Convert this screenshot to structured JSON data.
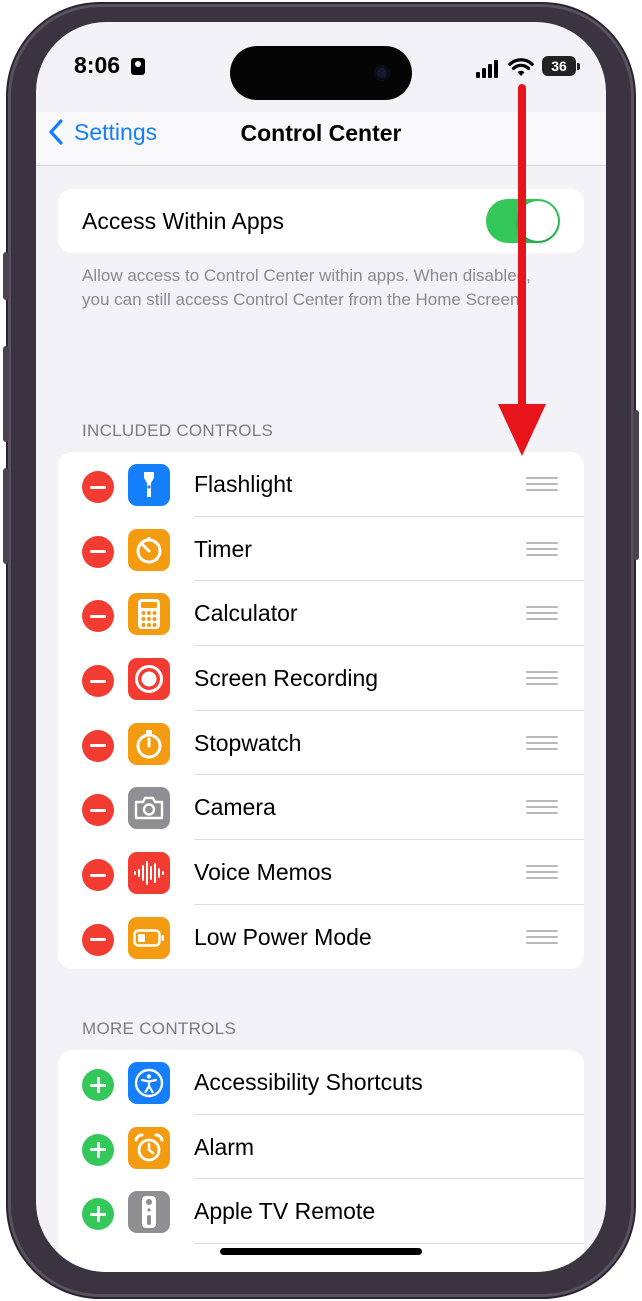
{
  "status": {
    "time": "8:06",
    "battery": "36"
  },
  "nav": {
    "back_label": "Settings",
    "title": "Control Center"
  },
  "access": {
    "label": "Access Within Apps",
    "enabled": true,
    "footnote": "Allow access to Control Center within apps. When disabled, you can still access Control Center from the Home Screen."
  },
  "included": {
    "header": "INCLUDED CONTROLS",
    "items": [
      {
        "label": "Flashlight",
        "icon": "flashlight-icon",
        "color": "#157efb"
      },
      {
        "label": "Timer",
        "icon": "timer-icon",
        "color": "#f39c12"
      },
      {
        "label": "Calculator",
        "icon": "calculator-icon",
        "color": "#f39c12"
      },
      {
        "label": "Screen Recording",
        "icon": "screen-recording-icon",
        "color": "#f23b31"
      },
      {
        "label": "Stopwatch",
        "icon": "stopwatch-icon",
        "color": "#f39c12"
      },
      {
        "label": "Camera",
        "icon": "camera-icon",
        "color": "#8e8e93"
      },
      {
        "label": "Voice Memos",
        "icon": "voice-memos-icon",
        "color": "#f23b31"
      },
      {
        "label": "Low Power Mode",
        "icon": "battery-icon",
        "color": "#f39c12"
      }
    ]
  },
  "more": {
    "header": "MORE CONTROLS",
    "items": [
      {
        "label": "Accessibility Shortcuts",
        "icon": "accessibility-icon",
        "color": "#157efb"
      },
      {
        "label": "Alarm",
        "icon": "alarm-icon",
        "color": "#f39c12"
      },
      {
        "label": "Apple TV Remote",
        "icon": "remote-icon",
        "color": "#8e8e93"
      }
    ]
  },
  "colors": {
    "accent": "#157efb",
    "toggle_on": "#34c759",
    "remove": "#f23b31",
    "add": "#34c759",
    "annotation_arrow": "#e8141c"
  }
}
